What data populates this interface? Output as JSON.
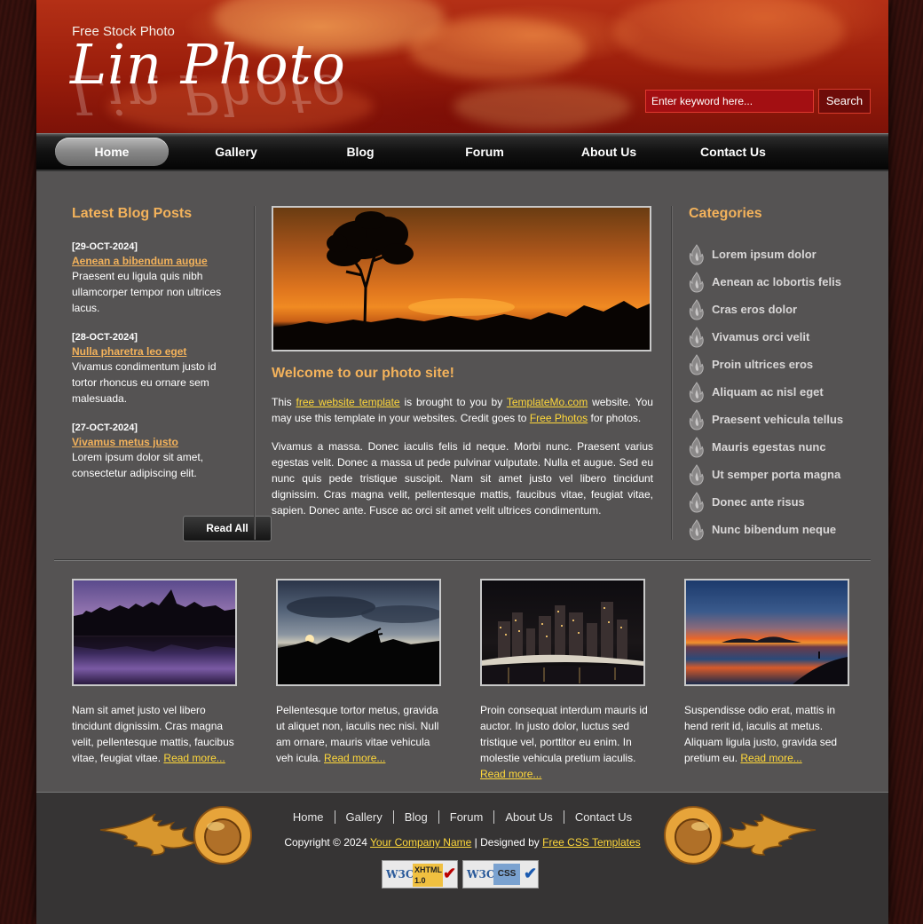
{
  "header": {
    "tagline": "Free Stock Photo",
    "logo": "Lin Photo",
    "search_placeholder": "Enter keyword here...",
    "search_button": "Search"
  },
  "nav": {
    "items": [
      "Home",
      "Gallery",
      "Blog",
      "Forum",
      "About Us",
      "Contact Us"
    ],
    "active": "Home"
  },
  "blog": {
    "heading": "Latest Blog Posts",
    "posts": [
      {
        "date": "[29-OCT-2024]",
        "title": "Aenean a bibendum augue",
        "text": "Praesent eu ligula quis nibh ullamcorper tempor non ultrices lacus."
      },
      {
        "date": "[28-OCT-2024]",
        "title": "Nulla pharetra leo eget",
        "text": "Vivamus condimentum justo id tortor rhoncus eu ornare sem malesuada."
      },
      {
        "date": "[27-OCT-2024]",
        "title": "Vivamus metus justo",
        "text": "Lorem ipsum dolor sit amet, consectetur adipiscing elit."
      }
    ],
    "read_all": "Read All"
  },
  "main": {
    "welcome": "Welcome to our photo site!",
    "intro": {
      "t1": "This ",
      "link1": "free website template",
      "t2": " is brought to you by ",
      "link2": "TemplateMo.com",
      "t3": " website. You may use this template in your websites. Credit goes to ",
      "link3": "Free Photos",
      "t4": " for photos."
    },
    "body": "Vivamus a massa. Donec iaculis felis id neque. Morbi nunc. Praesent varius egestas velit. Donec a massa ut pede pulvinar vulputate. Nulla et augue. Sed eu nunc quis pede tristique suscipit. Nam sit amet justo vel libero tincidunt dignissim. Cras magna velit, pellentesque mattis, faucibus vitae, feugiat vitae, sapien. Donec ante. Fusce ac orci sit amet velit ultrices condimentum."
  },
  "categories": {
    "heading": "Categories",
    "items": [
      "Lorem ipsum dolor",
      "Aenean ac lobortis felis",
      "Cras eros dolor",
      "Vivamus orci velit",
      "Proin ultrices eros",
      "Aliquam ac nisl eget",
      "Praesent vehicula tellus",
      "Mauris egestas nunc",
      "Ut semper porta magna",
      "Donec ante risus",
      "Nunc bibendum neque"
    ]
  },
  "gallery": {
    "read_more": "Read more...",
    "items": [
      {
        "text": "Nam sit amet justo vel libero tincidunt dignissim. Cras magna velit, pellentesque mattis, faucibus vitae, feugiat vitae. "
      },
      {
        "text": "Pellentesque tortor metus, gravida ut aliquet non, iaculis nec nisi. Null am ornare, mauris vitae vehicula veh icula. "
      },
      {
        "text": "Proin consequat interdum mauris id auctor. In justo dolor, luctus sed tristique vel, porttitor eu enim. In molestie vehicula pretium iaculis. "
      },
      {
        "text": "Suspendisse odio erat, mattis in hend rerit id, iaculis at metus. Aliquam ligula justo, gravida sed pretium eu. "
      }
    ]
  },
  "footer": {
    "nav": [
      "Home",
      "Gallery",
      "Blog",
      "Forum",
      "About Us",
      "Contact Us"
    ],
    "copyright_pre": "Copyright © 2024 ",
    "company": "Your Company Name",
    "designed_by": " | Designed by ",
    "designer": "Free CSS Templates",
    "badge_xhtml": "XHTML 1.0",
    "badge_css": "CSS",
    "w3c": "W3C"
  },
  "colors": {
    "accent": "#f3b25b",
    "link": "#ffd83a",
    "content_bg": "#555353",
    "header_red": "#9a1d0b"
  }
}
